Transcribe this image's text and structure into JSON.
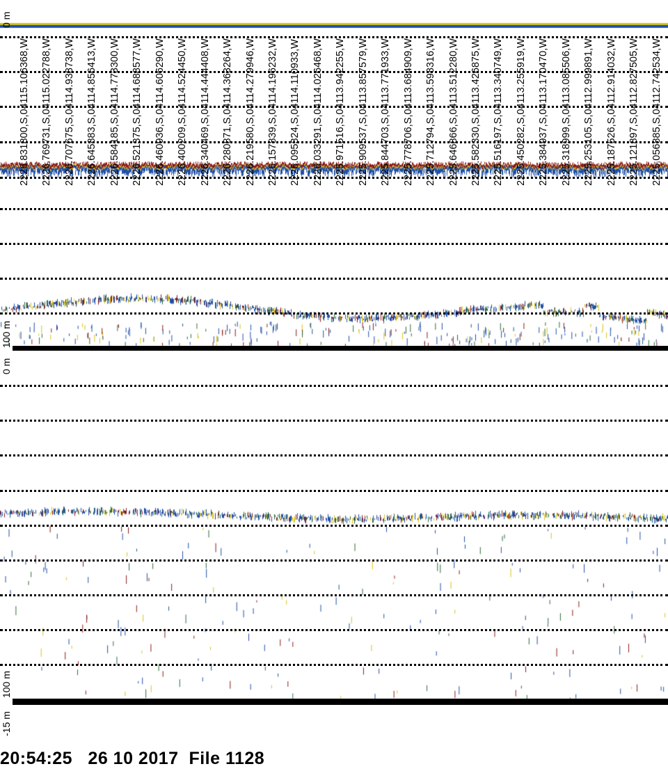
{
  "panel1": {
    "top_label": "0 m",
    "bottom_label": "100 m"
  },
  "panel2": {
    "top_label": "0 m",
    "bottom_label": "100 m",
    "offset_label": "-15 m"
  },
  "positions": [
    "2226.831800,S,04115.106368,W",
    "2226.769731,S,04115.022788,W",
    "2226.707675,S,04114.938738,W",
    "2226.645883,S,04114.856413,W",
    "2226.584185,S,04114.773300,W",
    "2226.521375,S,04114.688577,W",
    "2226.460936,S,04114.606290,W",
    "2226.400209,S,04114.524450,W",
    "2226.340469,S,04114.444408,W",
    "2226.280871,S,04114.363264,W",
    "2226.219580,S,04114.279946,W",
    "2226.157839,S,04114.196232,W",
    "2226.095324,S,04114.110933,W",
    "2226.033291,S,04114.026468,W",
    "2225.971516,S,04113.942255,W",
    "2225.909537,S,04113.857579,W",
    "2225.844703,S,04113.771933,W",
    "2225.778706,S,04113.684909,W",
    "2225.712794,S,04113.598316,W",
    "2225.646866,S,04113.512280,W",
    "2225.582330,S,04113.426875,W",
    "2225.516197,S,04113.340749,W",
    "2225.450282,S,04113.255919,W",
    "2225.384937,S,04113.170470,W",
    "2225.318999,S,04113.085506,W",
    "2225.253105,S,04112.999891,W",
    "2225.187526,S,04112.914032,W",
    "2225.121897,S,04112.827505,W",
    "2225.056885,S,04112.742534,W"
  ],
  "footer": {
    "time": "20:54:25",
    "date": "26 10 2017",
    "file": "File 1128"
  },
  "colors": {
    "blue": "#1f4fa8",
    "yellow": "#d8c21a",
    "red": "#8b1a1a",
    "green": "#2e6b3a"
  }
}
